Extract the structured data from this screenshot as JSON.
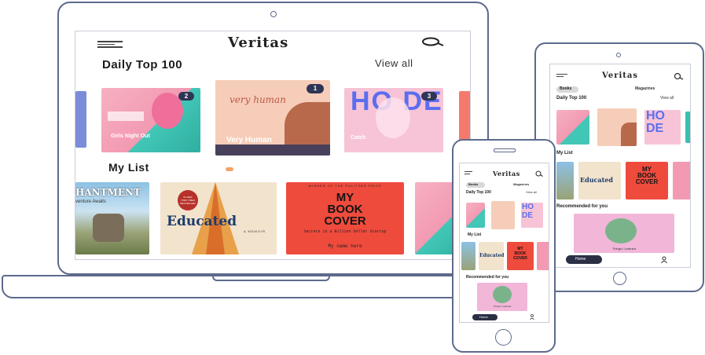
{
  "app": {
    "name": "Veritas"
  },
  "laptop": {
    "section_daily": "Daily Top 100",
    "view_all": "View all",
    "section_list": "My List",
    "top_books": [
      {
        "rank": "2",
        "title": "Girls Night Out"
      },
      {
        "rank": "1",
        "title": "Very Human",
        "cover_script": "very human"
      },
      {
        "rank": "3",
        "title": "Catch",
        "cover_art": "HO DE"
      }
    ],
    "list_books": [
      {
        "title_fragment": "HANTMENT",
        "subtitle_fragment": "venture Awaits"
      },
      {
        "title": "Educated",
        "kicker": "A MEMOIR",
        "badge": "#1 NEW YORK TIMES BESTSELLER"
      },
      {
        "title_line1": "MY",
        "title_line2": "BOOK",
        "title_line3": "COVER",
        "tagline": "Secrets in a Billion Dollar Startup",
        "top_note": "WINNER OF THE PULITZER PRIZE",
        "author": "My name here"
      }
    ]
  },
  "tablet": {
    "tabs": [
      "Books",
      "Magazines"
    ],
    "section_daily": "Daily Top 100",
    "view_all": "View all",
    "section_list": "My List",
    "section_recommended": "Recommended for you",
    "rec_title": "Things I Learned",
    "nav_home": "Home"
  },
  "phone": {
    "tabs": [
      "Books",
      "Magazines"
    ],
    "section_daily": "Daily Top 100",
    "view_all": "View all",
    "section_list": "My List",
    "section_recommended": "Recommended for you",
    "rec_title": "Things I Learned",
    "nav_home": "Home"
  },
  "colors": {
    "frame": "#5d6a8c",
    "rank_badge": "#2f3555",
    "accent_red": "#ef4b3d",
    "pink": "#f6a3b5",
    "teal": "#3bbfb3",
    "peach": "#f4cbb6"
  }
}
